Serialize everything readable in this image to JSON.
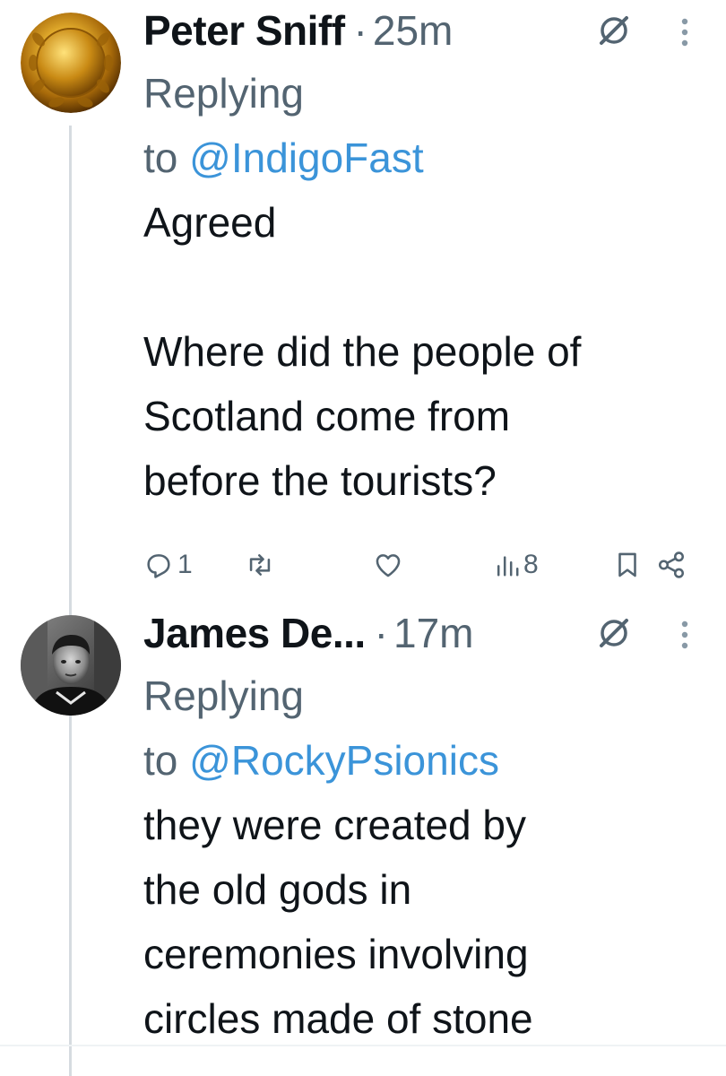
{
  "posts": [
    {
      "display_name": "Peter Sniff",
      "separator": "·",
      "time": "25m",
      "replying_prefix": "Replying",
      "replying_to": "to",
      "mention": "@IndigoFast",
      "body": "Agreed\n\nWhere did the people of\nScotland come from\nbefore the tourists?",
      "avatar_icon": "gold-laurel-medallion",
      "actions": {
        "reply_count": "1",
        "retweet_count": "",
        "like_count": "",
        "views_count": "8"
      }
    },
    {
      "display_name": "James De...",
      "separator": "·",
      "time": "17m",
      "replying_prefix": "Replying",
      "replying_to": "to",
      "mention": "@RockyPsionics",
      "body": "they were created by\nthe old gods in\nceremonies involving\ncircles made of stone",
      "avatar_icon": "black-and-white-portrait-photo"
    }
  ],
  "icons": {
    "reply": "reply-icon",
    "retweet": "retweet-icon",
    "like": "heart-icon",
    "views": "views-bar-icon",
    "bookmark": "bookmark-icon",
    "share": "share-icon",
    "grok": "grok-icon",
    "more": "more-vertical-icon"
  },
  "colors": {
    "text": "#0f1419",
    "secondary": "#536471",
    "mention": "#3b94d9",
    "thread_line": "#d6dbe0"
  }
}
